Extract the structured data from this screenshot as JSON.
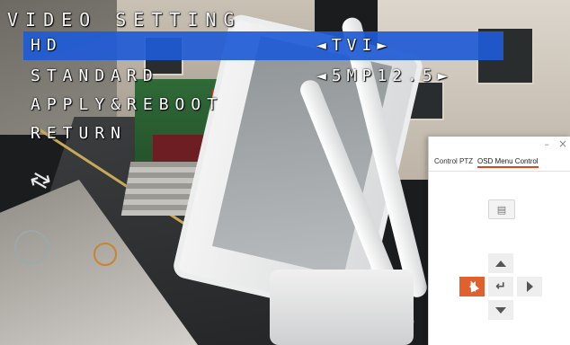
{
  "osd": {
    "title": "VIDEO SETTING",
    "menu_items": [
      {
        "label": "HD",
        "value": "◄TVI►",
        "selected": true
      },
      {
        "label": "STANDARD",
        "value": "◄5MP12.5►",
        "selected": false
      },
      {
        "label": "APPLY&REBOOT",
        "value": "",
        "selected": false
      },
      {
        "label": "RETURN",
        "value": "",
        "selected": false
      }
    ]
  },
  "panel": {
    "minimize_glyph": "–",
    "close_glyph": "×",
    "tabs": [
      {
        "label": "Control PTZ",
        "active": false
      },
      {
        "label": "OSD Menu Control",
        "active": true
      }
    ],
    "buttons": {
      "menu_glyph": "▤",
      "enter_glyph": "↵"
    },
    "accent_color": "#e0612d"
  },
  "colors": {
    "osd_highlight": "#1f5bd6",
    "osd_text": "#ffffff"
  }
}
